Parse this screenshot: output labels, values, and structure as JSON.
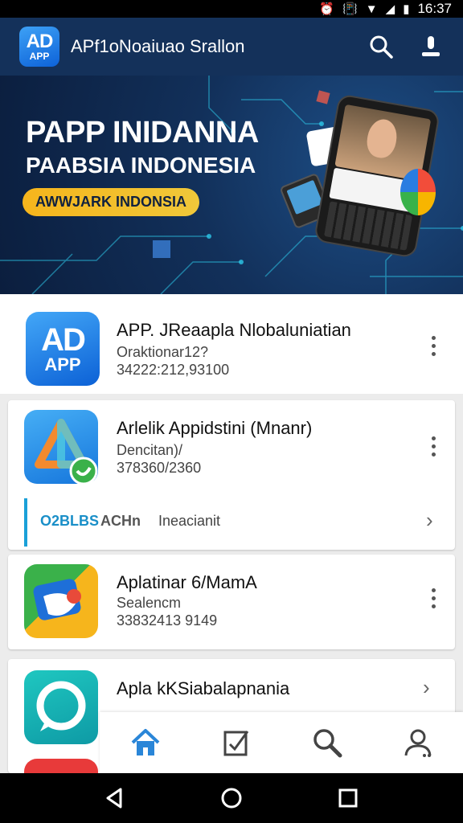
{
  "status_bar": {
    "time": "16:37"
  },
  "app_bar": {
    "logo_line1": "AD",
    "logo_line2": "APP",
    "title": "APf1oNoaiuao Srallon"
  },
  "banner": {
    "headline_1": "PAPP INIDANNA",
    "headline_2": "PAABSIA INDONESIA",
    "pill": "AWWJARK INDONSIA"
  },
  "list": {
    "items": [
      {
        "title": "APP. JReaapla Nlobaluniatian",
        "subtitle": "Oraktionar12?",
        "meta": "34222:212,93100",
        "logo_line1": "AD",
        "logo_line2": "APP"
      },
      {
        "title": "Arlelik Appidstini (Mnanr)",
        "subtitle": "Dencitan)/",
        "meta": "378360/2360"
      },
      {
        "title": "Aplatinar 6/MamA",
        "subtitle": "Sealencm",
        "meta": "33832413 9149"
      },
      {
        "title": "Apla kKSiabalapnania"
      }
    ],
    "subrow": {
      "tag_1": "O2BLBS",
      "tag_2": "ACHn",
      "label": "Ineacianit"
    }
  },
  "bottom_nav": {
    "items": [
      {
        "icon": "home-icon",
        "active": true
      },
      {
        "icon": "edit-icon",
        "active": false
      },
      {
        "icon": "search-icon",
        "active": false
      },
      {
        "icon": "profile-icon",
        "active": false
      }
    ]
  },
  "colors": {
    "app_bar": "#14315a",
    "accent": "#1a8fc8",
    "pill": "#f6b51c",
    "nav_active": "#2a86d8"
  }
}
